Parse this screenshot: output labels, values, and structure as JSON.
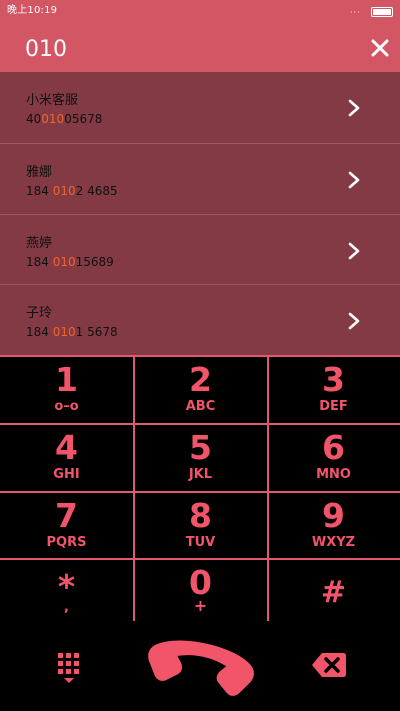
{
  "status_bar": {
    "time": "晚上10:19",
    "dots": "···"
  },
  "header": {
    "number": "010"
  },
  "results": [
    {
      "name": "小米客服",
      "num_pre": "40",
      "num_hl": "010",
      "num_post": "05678"
    },
    {
      "name": "雅娜",
      "num_pre": "184 ",
      "num_hl": "010",
      "num_post": "2 4685"
    },
    {
      "name": "燕婷",
      "num_pre": "184 ",
      "num_hl": "010",
      "num_post": "15689"
    },
    {
      "name": "子玲",
      "num_pre": "184 ",
      "num_hl": "010",
      "num_post": "1 5678"
    }
  ],
  "keypad": {
    "k1": {
      "digit": "1",
      "letters": "o–o"
    },
    "k2": {
      "digit": "2",
      "letters": "ABC"
    },
    "k3": {
      "digit": "3",
      "letters": "DEF"
    },
    "k4": {
      "digit": "4",
      "letters": "GHI"
    },
    "k5": {
      "digit": "5",
      "letters": "JKL"
    },
    "k6": {
      "digit": "6",
      "letters": "MNO"
    },
    "k7": {
      "digit": "7",
      "letters": "PQRS"
    },
    "k8": {
      "digit": "8",
      "letters": "TUV"
    },
    "k9": {
      "digit": "9",
      "letters": "WXYZ"
    },
    "kstar": {
      "digit": "*",
      "letters": ","
    },
    "k0": {
      "digit": "0",
      "letters": "+"
    },
    "khash": {
      "digit": "#",
      "letters": ""
    }
  },
  "colors": {
    "accent": "#d35665",
    "list_bg": "#833a45",
    "key_text": "#f25469",
    "highlight": "#f0642e",
    "grid_line": "#e05a6e"
  },
  "icons": {
    "close": "close-icon",
    "chevron": "chevron-right-icon",
    "dialpad": "dialpad-icon",
    "call": "phone-handset-icon",
    "backspace": "backspace-icon"
  }
}
